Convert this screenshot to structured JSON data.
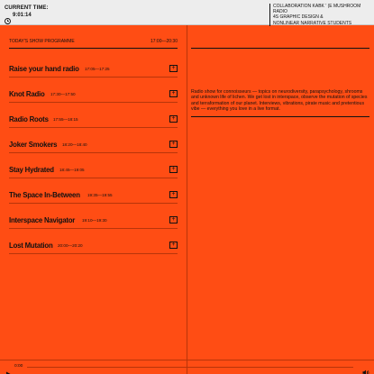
{
  "header": {
    "clock_label": "CURRENT TIME:",
    "clock_time": "9:01:14",
    "clock_icon": "clock-icon",
    "collab_lines": [
      "COLLABORATION KABK ’ (e MUSHROOM RADIO",
      "4S GRAPHIC DESIGN &",
      "NONLINEAR NARRATIVE STUDENTS"
    ]
  },
  "programme": {
    "heading": "TODAY'S SHOW PROGRAMME",
    "range": "17:00—20:30",
    "add_icon": "plus-icon",
    "shows": [
      {
        "title": "Raise your hand radio",
        "time": "17:05—17:25"
      },
      {
        "title": "Knot Radio",
        "time": "17:30—17:50"
      },
      {
        "title": "Radio Roots",
        "time": "17:55—18:15"
      },
      {
        "title": "Joker Smokers",
        "time": "18:20—18:40"
      },
      {
        "title": "Stay Hydrated",
        "time": "18:45—19:05"
      },
      {
        "title": "The Space In-Between",
        "time": "19:35—19:55"
      },
      {
        "title": "Interspace Navigator",
        "time": "19:10—19:30"
      },
      {
        "title": "Lost Mutation",
        "time": "20:00—20:20"
      }
    ]
  },
  "description": "Radio show for connoisseurs — topics on neurodiversity, parapsychology, shrooms and unknown life of lichen. We get lost in interspace, observe the mutation of species and terraformation of our planet. Interviews, vibrations, pirate music and pretentious vibe — everything you love in a live format.",
  "player": {
    "play_icon": "play-icon",
    "time": "0:00",
    "volume_icon": "volume-icon"
  },
  "colors": {
    "background": "#ff4d14",
    "topbar": "#ededed",
    "ink": "#111111"
  }
}
